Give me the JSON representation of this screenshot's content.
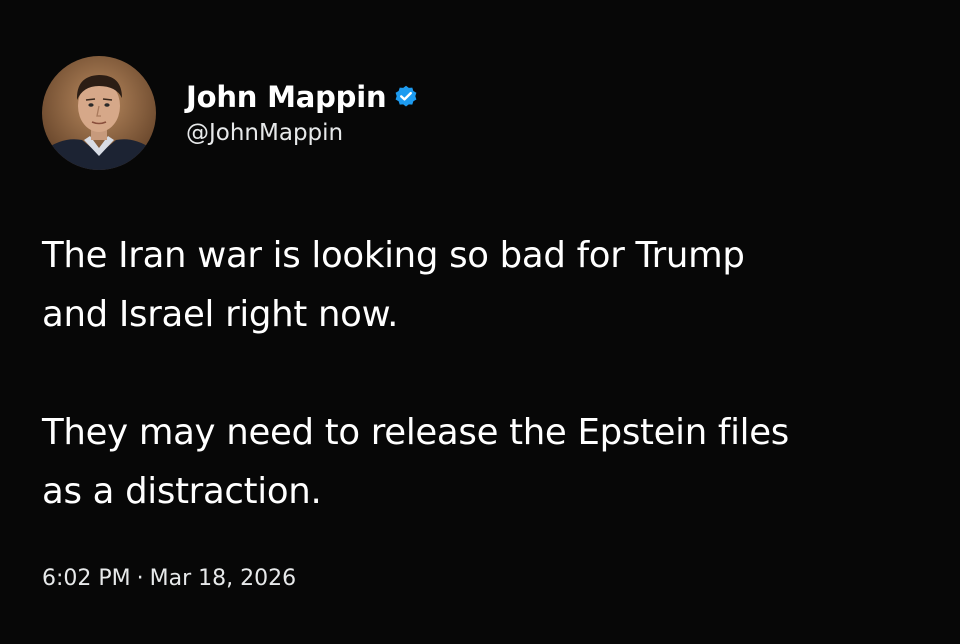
{
  "author": {
    "display_name": "John Mappin",
    "handle": "@JohnMappin",
    "verified": true,
    "verified_icon": "verified-badge-icon",
    "verified_color": "#1d9bf0"
  },
  "tweet": {
    "paragraphs": [
      "The Iran war is looking so bad for Trump\nand Israel right now.",
      "They may need to release the Epstein files\nas a distraction."
    ],
    "time": "6:02 PM",
    "separator": "·",
    "date": "Mar 18, 2026"
  },
  "colors": {
    "background": "#070707",
    "text": "#ffffff"
  }
}
